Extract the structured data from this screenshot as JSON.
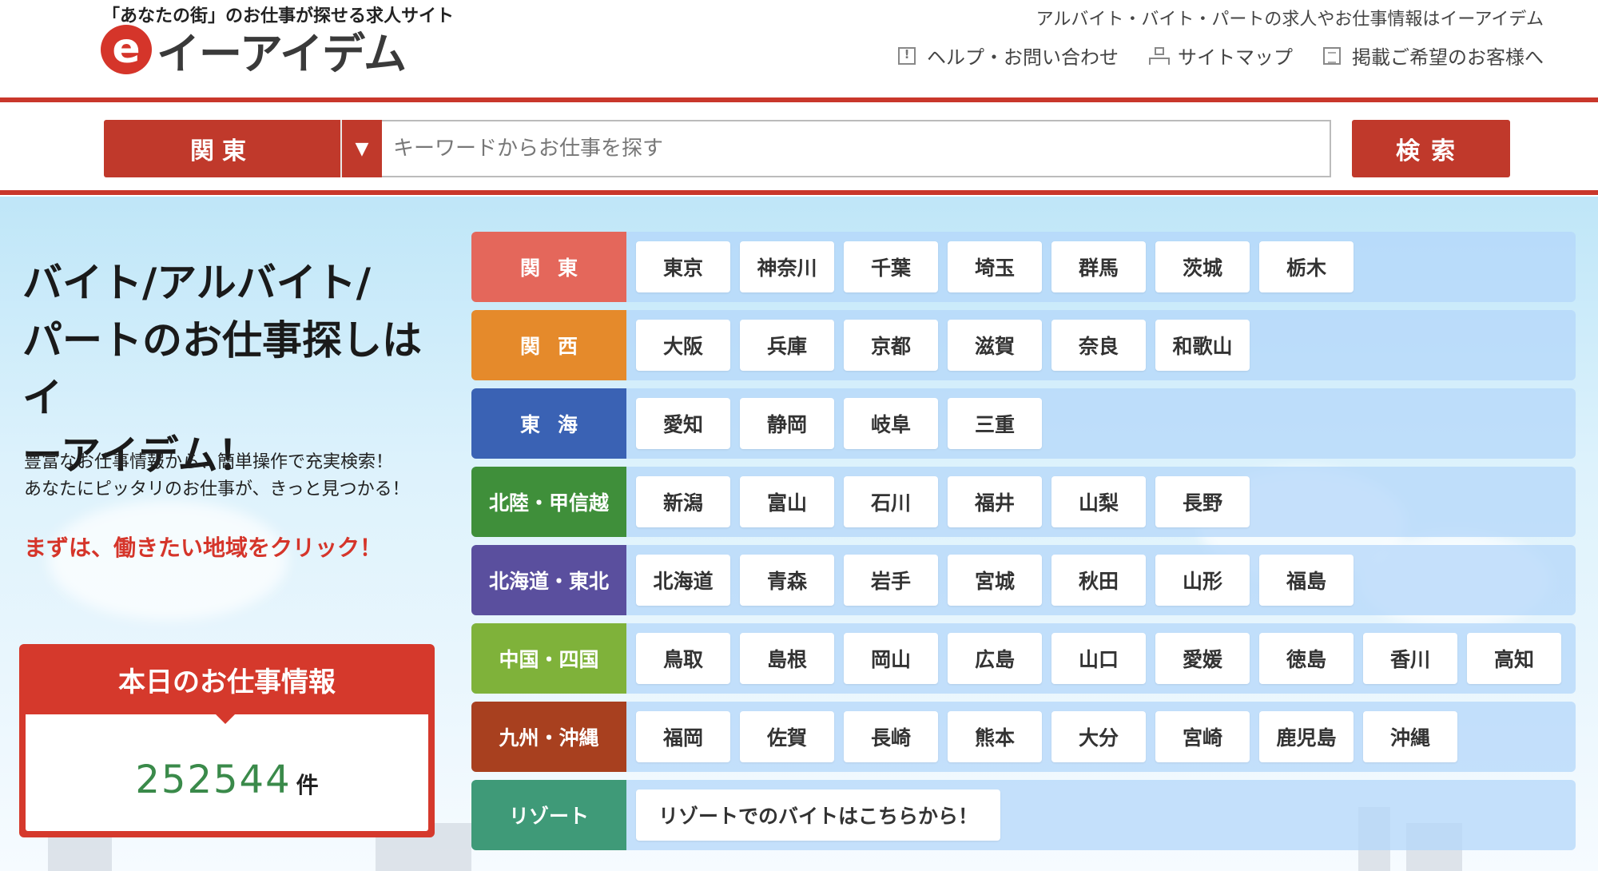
{
  "header": {
    "tagline": "「あなたの街」のお仕事が探せる求人サイト",
    "logo_mark": "e",
    "logo_text": "イーアイデム",
    "right_text": "アルバイト・バイト・パートの求人やお仕事情報はイーアイデム",
    "links": {
      "help": "ヘルプ・お問い合わせ",
      "sitemap": "サイトマップ",
      "advertise": "掲載ご希望のお客様へ"
    }
  },
  "search": {
    "region": "関東",
    "arrow": "▼",
    "placeholder": "キーワードからお仕事を探す",
    "button": "検索"
  },
  "intro": {
    "headline_1": "バイト/アルバイト/",
    "headline_2": "パートのお仕事探しはイ",
    "headline_3": "ーアイデム！",
    "desc_1": "豊富なお仕事情報から、簡単操作で充実検索！",
    "desc_2": "あなたにピッタリのお仕事が、きっと見つかる！",
    "cta": "まずは、働きたい地域をクリック！"
  },
  "today": {
    "title": "本日のお仕事情報",
    "count": "252544",
    "unit": "件"
  },
  "regions": [
    {
      "label": "関東",
      "color": "#e4675b",
      "prefs": [
        "東京",
        "神奈川",
        "千葉",
        "埼玉",
        "群馬",
        "茨城",
        "栃木"
      ]
    },
    {
      "label": "関西",
      "color": "#e58a2b",
      "prefs": [
        "大阪",
        "兵庫",
        "京都",
        "滋賀",
        "奈良",
        "和歌山"
      ]
    },
    {
      "label": "東海",
      "color": "#3a62b4",
      "prefs": [
        "愛知",
        "静岡",
        "岐阜",
        "三重"
      ]
    },
    {
      "label": "北陸・甲信越",
      "color": "#3f8f3a",
      "prefs": [
        "新潟",
        "富山",
        "石川",
        "福井",
        "山梨",
        "長野"
      ]
    },
    {
      "label": "北海道・東北",
      "color": "#5a4f9e",
      "prefs": [
        "北海道",
        "青森",
        "岩手",
        "宮城",
        "秋田",
        "山形",
        "福島"
      ]
    },
    {
      "label": "中国・四国",
      "color": "#7fb23a",
      "prefs": [
        "鳥取",
        "島根",
        "岡山",
        "広島",
        "山口",
        "愛媛",
        "徳島",
        "香川",
        "高知"
      ]
    },
    {
      "label": "九州・沖縄",
      "color": "#a8401f",
      "prefs": [
        "福岡",
        "佐賀",
        "長崎",
        "熊本",
        "大分",
        "宮崎",
        "鹿児島",
        "沖縄"
      ]
    },
    {
      "label": "リゾート",
      "color": "#3f9a78",
      "prefs": [
        "リゾートでのバイトはこちらから！"
      ]
    }
  ]
}
